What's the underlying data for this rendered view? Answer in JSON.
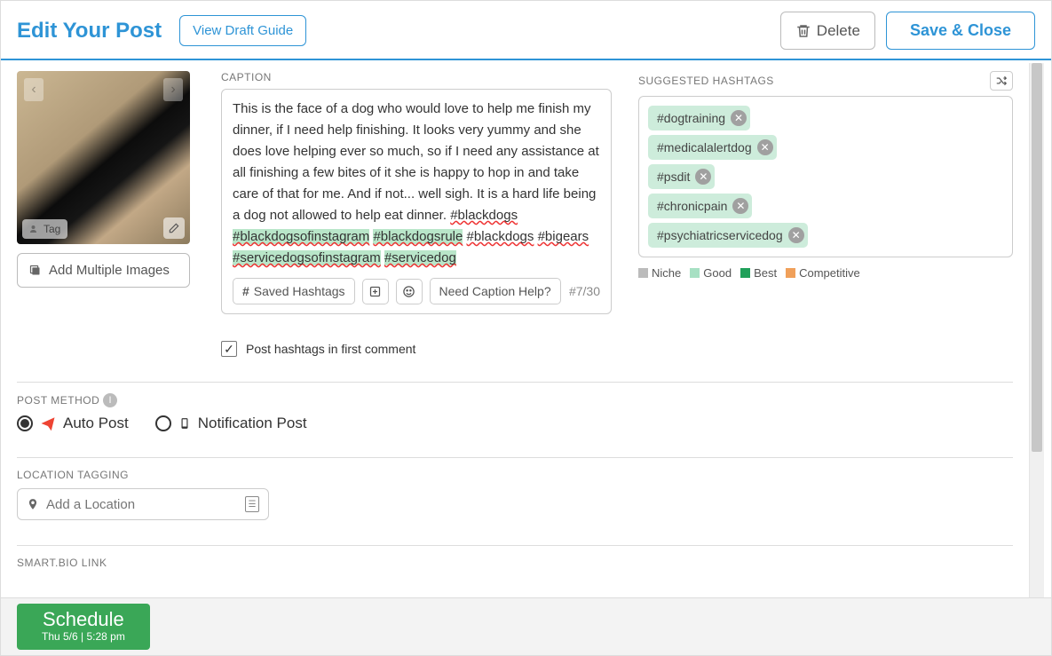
{
  "header": {
    "title": "Edit Your Post",
    "draft_guide": "View Draft Guide",
    "delete": "Delete",
    "save": "Save & Close"
  },
  "image": {
    "tag_label": "Tag",
    "add_multiple": "Add Multiple Images"
  },
  "caption": {
    "label": "CAPTION",
    "body": "This is the face of a dog who would love to help me finish my dinner, if I need help finishing. It looks very yummy and she does love helping ever so much, so if I need any assistance at all finishing a few bites of it she is happy to hop in and take care of that for me. And if not... well sigh. It is a hard life being a dog not allowed to help eat dinner. ",
    "hashtags_inline": [
      "#blackdogs",
      "#blackdogsofinstagram",
      "#blackdogsrule",
      "#blackdogs",
      "#bigears",
      "#servicedogsofinstagram",
      "#servicedog"
    ],
    "saved_hashtags": "Saved Hashtags",
    "need_help": "Need Caption Help?",
    "counter": "#7/30"
  },
  "first_comment": {
    "label": "Post hashtags in first comment",
    "checked": true
  },
  "suggested": {
    "label": "SUGGESTED HASHTAGS",
    "tags": [
      "#dogtraining",
      "#medicalalertdog",
      "#psdit",
      "#chronicpain",
      "#psychiatricservicedog"
    ],
    "legend": {
      "niche": "Niche",
      "good": "Good",
      "best": "Best",
      "competitive": "Competitive"
    }
  },
  "post_method": {
    "label": "POST METHOD",
    "auto": "Auto Post",
    "notification": "Notification Post",
    "selected": "auto"
  },
  "location": {
    "label": "LOCATION TAGGING",
    "placeholder": "Add a Location"
  },
  "smartbio": {
    "label": "SMART.BIO LINK"
  },
  "footer": {
    "schedule": "Schedule",
    "schedule_time": "Thu 5/6 | 5:28 pm"
  }
}
